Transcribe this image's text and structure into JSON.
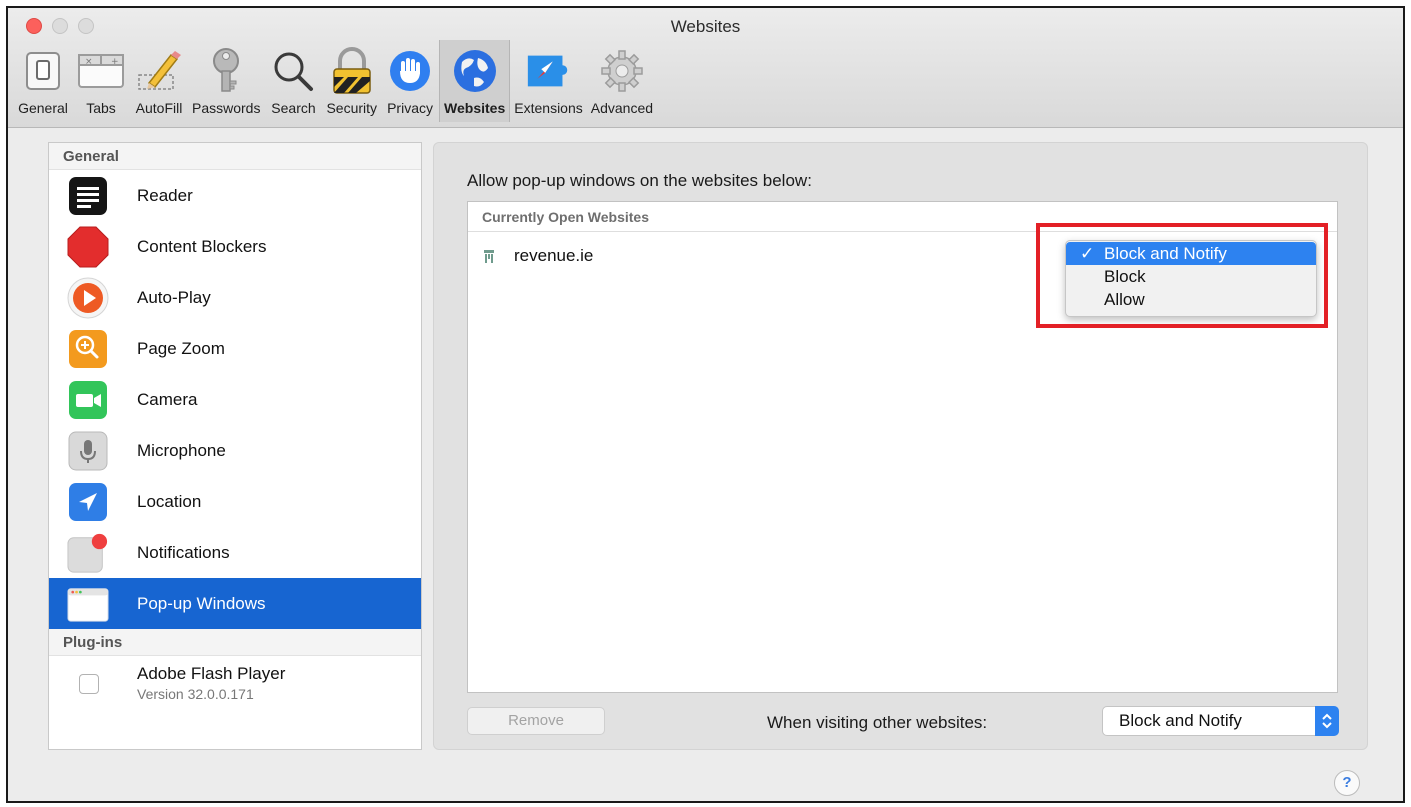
{
  "window": {
    "title": "Websites"
  },
  "toolbar": {
    "tabs": [
      {
        "label": "General",
        "icon": "general-switch-icon"
      },
      {
        "label": "Tabs",
        "icon": "tabs-icon"
      },
      {
        "label": "AutoFill",
        "icon": "pencil-form-icon"
      },
      {
        "label": "Passwords",
        "icon": "key-icon"
      },
      {
        "label": "Search",
        "icon": "magnifier-icon"
      },
      {
        "label": "Security",
        "icon": "padlock-icon"
      },
      {
        "label": "Privacy",
        "icon": "hand-icon"
      },
      {
        "label": "Websites",
        "icon": "globe-icon",
        "active": true
      },
      {
        "label": "Extensions",
        "icon": "puzzle-compass-icon"
      },
      {
        "label": "Advanced",
        "icon": "gear-icon"
      }
    ]
  },
  "sidebar": {
    "general_header": "General",
    "items": [
      {
        "label": "Reader",
        "icon": "reader-icon"
      },
      {
        "label": "Content Blockers",
        "icon": "stop-sign-icon"
      },
      {
        "label": "Auto-Play",
        "icon": "play-icon"
      },
      {
        "label": "Page Zoom",
        "icon": "zoom-icon"
      },
      {
        "label": "Camera",
        "icon": "camera-icon"
      },
      {
        "label": "Microphone",
        "icon": "microphone-icon"
      },
      {
        "label": "Location",
        "icon": "location-arrow-icon"
      },
      {
        "label": "Notifications",
        "icon": "notification-badge-icon"
      },
      {
        "label": "Pop-up Windows",
        "icon": "popup-window-icon",
        "selected": true
      }
    ],
    "plugins_header": "Plug-ins",
    "plugins": [
      {
        "name": "Adobe Flash Player",
        "version": "Version 32.0.0.171",
        "checked": false
      }
    ]
  },
  "main": {
    "caption": "Allow pop-up windows on the websites below:",
    "table_header": "Currently Open Websites",
    "site": "revenue.ie",
    "site_menu": {
      "selected": "Block and Notify",
      "options": [
        "Block and Notify",
        "Block",
        "Allow"
      ],
      "check_glyph": "✓"
    },
    "remove_label": "Remove",
    "other_label": "When visiting other websites:",
    "other_value": "Block and Notify",
    "help_label": "?"
  },
  "colors": {
    "selection": "#1765d1",
    "menu_highlight": "#2d82f0",
    "annotation_red": "#e32026"
  }
}
